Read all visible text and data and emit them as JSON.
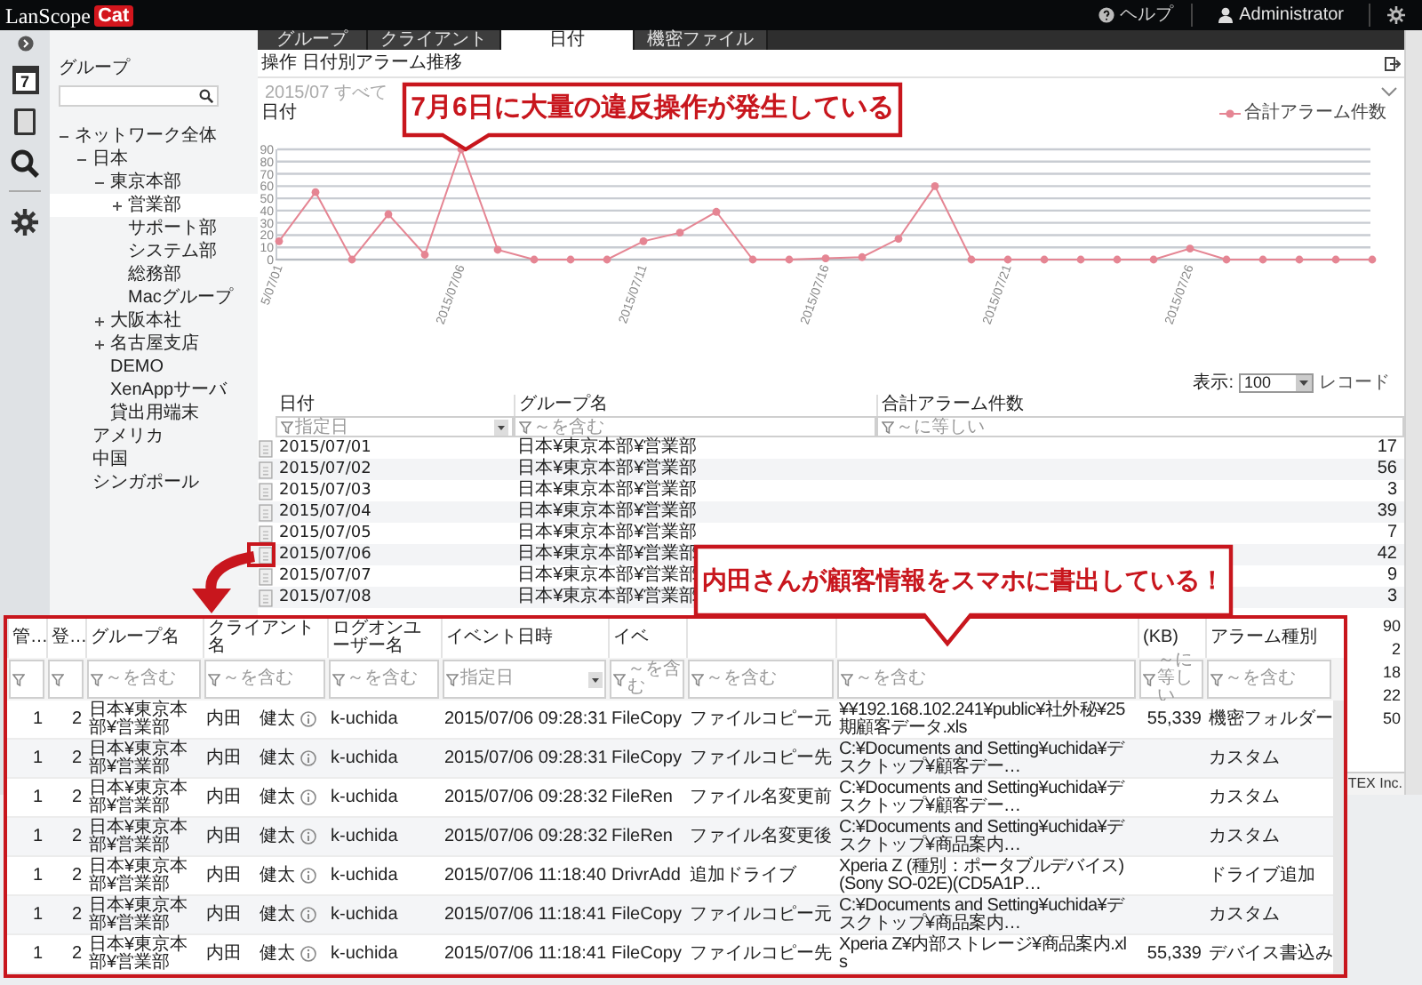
{
  "app": {
    "logo": "LanScope",
    "badge": "Cat"
  },
  "header": {
    "help": "ヘルプ",
    "user": "Administrator"
  },
  "rail": {
    "calendar_day": "7"
  },
  "tabs": [
    {
      "label": "グループ",
      "selected": false
    },
    {
      "label": "クライアント",
      "selected": false
    },
    {
      "label": "日付",
      "selected": true
    },
    {
      "label": "機密ファイル",
      "selected": false
    }
  ],
  "sidebar": {
    "title": "グループ",
    "tree": [
      {
        "label": "ネットワーク全体",
        "expanded": true,
        "selected": false,
        "children": [
          {
            "label": "日本",
            "expanded": true,
            "selected": false,
            "children": [
              {
                "label": "東京本部",
                "expanded": true,
                "selected": false,
                "children": [
                  {
                    "label": "営業部",
                    "expanded": false,
                    "selected": true
                  },
                  {
                    "label": "サポート部",
                    "selected": false
                  },
                  {
                    "label": "システム部",
                    "selected": false
                  },
                  {
                    "label": "総務部",
                    "selected": false
                  },
                  {
                    "label": "Macグループ",
                    "selected": false
                  }
                ]
              },
              {
                "label": "大阪本社",
                "expanded": false,
                "selected": false
              },
              {
                "label": "名古屋支店",
                "expanded": false,
                "selected": false
              },
              {
                "label": "DEMO",
                "selected": false
              },
              {
                "label": "XenAppサーバ",
                "selected": false
              },
              {
                "label": "貸出用端末",
                "selected": false
              }
            ]
          },
          {
            "label": "アメリカ",
            "selected": false
          },
          {
            "label": "中国",
            "selected": false
          },
          {
            "label": "シンガポール",
            "selected": false
          }
        ]
      }
    ]
  },
  "page_title": "操作 日付別アラーム推移",
  "chart": {
    "caption": "2015/07 すべて",
    "label": "日付",
    "chart_data": {
      "type": "line",
      "categories": [
        "5/07/01",
        null,
        null,
        null,
        null,
        "2015/07/06",
        null,
        null,
        null,
        null,
        "2015/07/11",
        null,
        null,
        null,
        null,
        "2015/07/16",
        null,
        null,
        null,
        null,
        "2015/07/21",
        null,
        null,
        null,
        null,
        "2015/07/26",
        null,
        null,
        null,
        null,
        null
      ],
      "series": [
        {
          "name": "合計アラーム件数",
          "color": "#e58593",
          "marker": "circle",
          "values": [
            15,
            55,
            0,
            37,
            4,
            90,
            8,
            0,
            0,
            0,
            15,
            22,
            39,
            0,
            0,
            1,
            2,
            17,
            60,
            0,
            0,
            0,
            0,
            0,
            0,
            9,
            0,
            0,
            0,
            0,
            0
          ]
        }
      ],
      "grid": true,
      "ylim": [
        0,
        90
      ],
      "yticks": [
        0,
        10,
        20,
        30,
        40,
        50,
        60,
        70,
        80,
        90
      ]
    }
  },
  "paging": {
    "label": "表示:",
    "value": "100",
    "unit": "レコード"
  },
  "table": {
    "columns": [
      {
        "label": "日付",
        "filter": "指定日",
        "kind": "date"
      },
      {
        "label": "グループ名",
        "filter": "～を含む",
        "kind": "text"
      },
      {
        "label": "合計アラーム件数",
        "filter": "～に等しい",
        "kind": "number"
      }
    ],
    "rows": [
      {
        "cells": [
          "2015/07/01",
          "日本¥東京本部¥営業部",
          "17"
        ],
        "marked": false
      },
      {
        "cells": [
          "2015/07/02",
          "日本¥東京本部¥営業部",
          "56"
        ],
        "marked": false
      },
      {
        "cells": [
          "2015/07/03",
          "日本¥東京本部¥営業部",
          "3"
        ],
        "marked": false
      },
      {
        "cells": [
          "2015/07/04",
          "日本¥東京本部¥営業部",
          "39"
        ],
        "marked": false
      },
      {
        "cells": [
          "2015/07/05",
          "日本¥東京本部¥営業部",
          "7"
        ],
        "marked": false
      },
      {
        "cells": [
          "2015/07/06",
          "日本¥東京本部¥営業部",
          "42"
        ],
        "marked": true
      },
      {
        "cells": [
          "2015/07/07",
          "日本¥東京本部¥営業部",
          "9"
        ],
        "marked": false
      },
      {
        "cells": [
          "2015/07/08",
          "日本¥東京本部¥営業部",
          "3"
        ],
        "marked": false
      }
    ]
  },
  "behind_values": [
    "90",
    "2",
    "18",
    "22",
    "50"
  ],
  "footer": "TEX Inc.",
  "callouts": [
    {
      "text": "7月6日に大量の違反操作が発生している"
    },
    {
      "text": "内田さんが顧客情報をスマホに書出している！"
    }
  ],
  "detail": {
    "columns": [
      {
        "label": "管…",
        "kind": "number"
      },
      {
        "label": "登…",
        "kind": "number"
      },
      {
        "label": "グループ名",
        "filter": "～を含む",
        "kind": "text"
      },
      {
        "label": "クライアント名",
        "filter": "～を含む",
        "kind": "user"
      },
      {
        "label": "ログオンユーザー名",
        "filter": "～を含む",
        "kind": "text"
      },
      {
        "label": "イベント日時",
        "filter": "指定日",
        "kind": "date"
      },
      {
        "label": "イベ",
        "filter": "～を含む",
        "kind": "text"
      },
      {
        "filter": "～を含む",
        "kind": "text"
      },
      {
        "filter": "～を含む",
        "kind": "path"
      },
      {
        "label": "(KB)",
        "filter": "～に等しい",
        "kind": "number"
      },
      {
        "label": "アラーム種別",
        "filter": "～を含む",
        "kind": "text"
      }
    ],
    "rows": [
      [
        "1",
        "2",
        "日本¥東京本部¥営業部",
        "内田　健太",
        "k-uchida",
        "2015/07/06 09:28:31",
        "FileCopy",
        "ファイルコピー元",
        "¥¥192.168.102.241¥public¥社外秘¥25期顧客データ.xls",
        "55,339",
        "機密フォルダー"
      ],
      [
        "1",
        "2",
        "日本¥東京本部¥営業部",
        "内田　健太",
        "k-uchida",
        "2015/07/06 09:28:31",
        "FileCopy",
        "ファイルコピー先",
        "C:¥Documents and Setting¥uchida¥デスクトップ¥顧客デー…",
        "",
        "カスタム"
      ],
      [
        "1",
        "2",
        "日本¥東京本部¥営業部",
        "内田　健太",
        "k-uchida",
        "2015/07/06 09:28:32",
        "FileRen",
        "ファイル名変更前",
        "C:¥Documents and Setting¥uchida¥デスクトップ¥顧客デー…",
        "",
        "カスタム"
      ],
      [
        "1",
        "2",
        "日本¥東京本部¥営業部",
        "内田　健太",
        "k-uchida",
        "2015/07/06 09:28:32",
        "FileRen",
        "ファイル名変更後",
        "C:¥Documents and Setting¥uchida¥デスクトップ¥商品案内…",
        "",
        "カスタム"
      ],
      [
        "1",
        "2",
        "日本¥東京本部¥営業部",
        "内田　健太",
        "k-uchida",
        "2015/07/06 11:18:40",
        "DrivrAdd",
        "追加ドライブ",
        "Xperia Z (種別：ポータブルデバイス)(Sony SO-02E)(CD5A1P…",
        "",
        "ドライブ追加"
      ],
      [
        "1",
        "2",
        "日本¥東京本部¥営業部",
        "内田　健太",
        "k-uchida",
        "2015/07/06 11:18:41",
        "FileCopy",
        "ファイルコピー元",
        "C:¥Documents and Setting¥uchida¥デスクトップ¥商品案内…",
        "",
        "カスタム"
      ],
      [
        "1",
        "2",
        "日本¥東京本部¥営業部",
        "内田　健太",
        "k-uchida",
        "2015/07/06 11:18:41",
        "FileCopy",
        "ファイルコピー先",
        "Xperia Z¥内部ストレージ¥商品案内.xls",
        "55,339",
        "デバイス書込み"
      ]
    ]
  }
}
